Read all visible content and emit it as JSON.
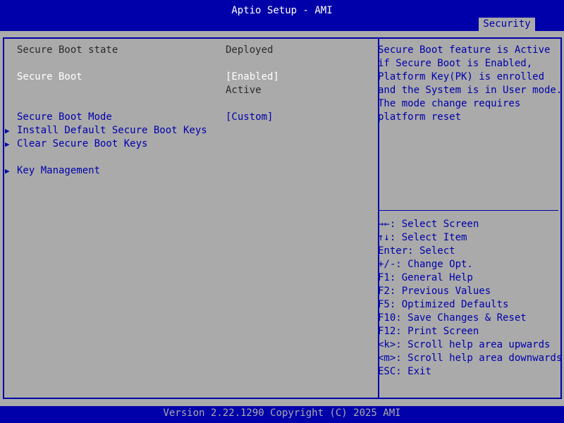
{
  "app": {
    "title": "Aptio Setup - AMI",
    "version_line": "Version 2.22.1290 Copyright (C) 2025 AMI"
  },
  "tabs": [
    {
      "label": "Security",
      "active": true
    }
  ],
  "settings": {
    "secure_boot_state_label": "Secure Boot state",
    "secure_boot_state_value": "Deployed",
    "secure_boot_label": "Secure Boot",
    "secure_boot_value": "[Enabled]",
    "secure_boot_status": "Active",
    "secure_boot_mode_label": "Secure Boot Mode",
    "secure_boot_mode_value": "[Custom]",
    "submenus": [
      {
        "label": "Install Default Secure Boot Keys",
        "icon": "triangle-right-icon"
      },
      {
        "label": "Clear Secure Boot Keys",
        "icon": "triangle-right-icon"
      },
      {
        "label": "Key Management",
        "icon": "triangle-right-icon"
      }
    ]
  },
  "help": {
    "lines": [
      "Secure Boot feature is Active",
      "if Secure Boot is Enabled,",
      "Platform Key(PK) is enrolled",
      "and the System is in User mode.",
      "The mode change requires",
      "platform reset"
    ]
  },
  "keys": [
    "→←: Select Screen",
    "↑↓: Select Item",
    "Enter: Select",
    "+/-: Change Opt.",
    "F1: General Help",
    "F2: Previous Values",
    "F5: Optimized Defaults",
    "F10: Save Changes & Reset",
    "F12: Print Screen",
    "<k>: Scroll help area upwards",
    "<m>: Scroll help area downwards",
    "ESC: Exit"
  ],
  "colors": {
    "background": "#0000aa",
    "panel": "#aaaaaa",
    "highlight_text": "#ffffff",
    "accent_text": "#0000aa"
  }
}
